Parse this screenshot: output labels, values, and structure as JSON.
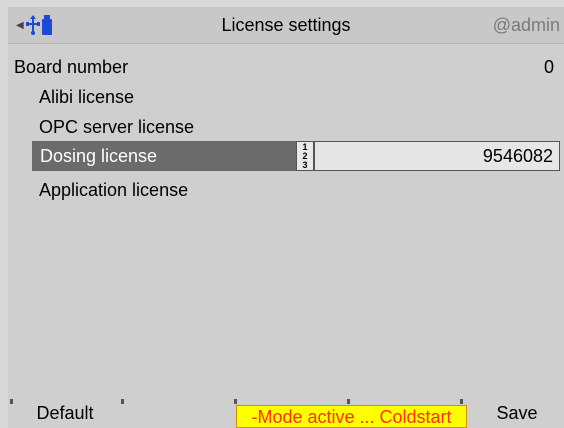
{
  "header": {
    "title": "License settings",
    "user": "@admin",
    "icons": [
      "left-arrow-icon",
      "network-icon",
      "usb-stick-icon"
    ],
    "accent_color": "#1a4bd6"
  },
  "board": {
    "label": "Board number",
    "value": "0"
  },
  "licenses": {
    "alibi": "Alibi license",
    "opc": "OPC server license",
    "dosing": "Dosing license",
    "dosing_value": "9546082",
    "application": "Application license"
  },
  "input_mode_icon": {
    "line1": "1",
    "line2": "2",
    "line3": "3"
  },
  "footer": {
    "default_label": "Default",
    "status_text": "-Mode active ... Coldstart",
    "save_label": "Save",
    "status_bg": "#ffff00",
    "status_fg": "#ff3300"
  }
}
